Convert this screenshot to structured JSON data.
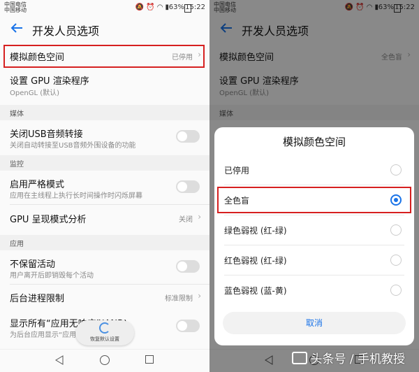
{
  "status": {
    "carrier_line1": "中国电信",
    "carrier_line2": "中国移动",
    "battery": "63%",
    "time": "15:22"
  },
  "appbar": {
    "title": "开发人员选项"
  },
  "left": {
    "settings": [
      {
        "label": "模拟颜色空间",
        "value": "已停用"
      },
      {
        "label": "设置 GPU 渲染程序",
        "sub": "OpenGL (默认)"
      }
    ],
    "sections": {
      "media": "媒体",
      "monitor": "监控",
      "apps": "应用"
    },
    "usb": {
      "label": "关闭USB音频转接",
      "sub": "关闭自动转接至USB音频外围设备的功能"
    },
    "strict": {
      "label": "启用严格模式",
      "sub": "应用在主线程上执行长时间操作时闪烁屏幕"
    },
    "gpu_profile": {
      "label": "GPU 呈现模式分析",
      "value": "关闭"
    },
    "keep_activities": {
      "label": "不保留活动",
      "sub": "用户离开后即销毁每个活动"
    },
    "bg_limit": {
      "label": "后台进程限制",
      "value": "标准限制"
    },
    "anr": {
      "label": "显示所有“应用无响应”(ANR)",
      "sub": "为后台应用显示“应用"
    },
    "restore_label": "恢复默认设置"
  },
  "right": {
    "settings": [
      {
        "label": "模拟颜色空间",
        "value": "全色盲"
      },
      {
        "label": "设置 GPU 渲染程序",
        "sub": "OpenGL (默认)"
      }
    ],
    "section_media": "媒体"
  },
  "dialog": {
    "title": "模拟颜色空间",
    "options": [
      {
        "label": "已停用",
        "selected": false
      },
      {
        "label": "全色盲",
        "selected": true
      },
      {
        "label": "绿色弱视 (红-绿)",
        "selected": false
      },
      {
        "label": "红色弱视 (红-绿)",
        "selected": false
      },
      {
        "label": "蓝色弱视 (蓝-黄)",
        "selected": false
      }
    ],
    "cancel": "取消"
  },
  "watermark": "头条号 / 手机教授",
  "colors": {
    "accent": "#1a73e8",
    "highlight": "#d62020"
  }
}
